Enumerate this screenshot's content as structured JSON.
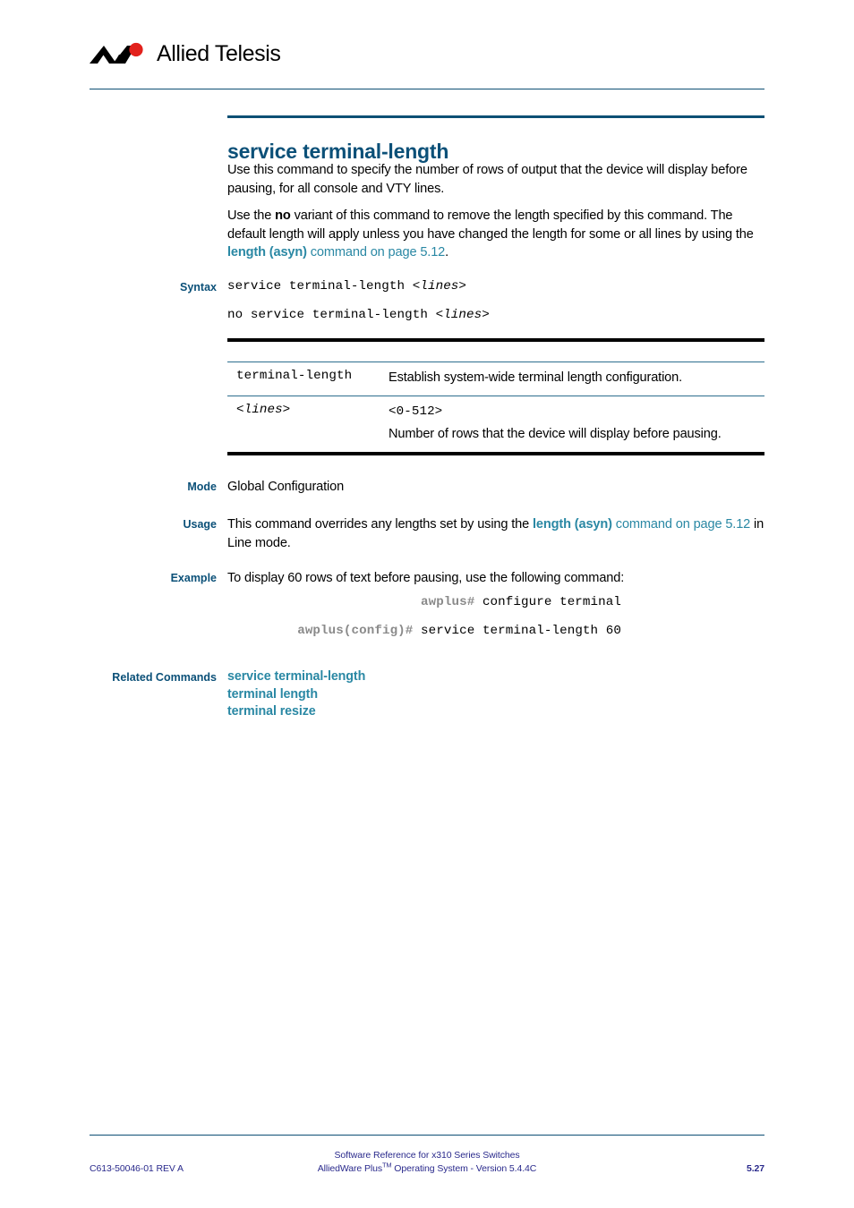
{
  "header": {
    "logo_text": "Allied Telesis",
    "logo_icon": "allied-telesis-chevron-logo"
  },
  "page_title": "service terminal-length",
  "intro": {
    "p1": "Use this command to specify the number of rows of output that the device will display before pausing, for all console and VTY lines.",
    "p2_part1": "Use the ",
    "p2_bold": "no",
    "p2_part2": " variant of this command to remove the length specified by this command. The default length will apply unless you have changed the length for some or all lines by using the ",
    "p2_link_bold": "length (asyn)",
    "p2_link_rest": " command on page 5.12",
    "p2_end": "."
  },
  "syntax": {
    "label": "Syntax",
    "line1_plain": "service terminal-length ",
    "line1_italic": "<lines>",
    "line2_plain": "no service terminal-length ",
    "line2_italic": "<lines>"
  },
  "param_table": {
    "rows": [
      {
        "key": "terminal-length",
        "key_style": "mono",
        "value_mono": "",
        "value_text": "Establish system-wide terminal length configuration."
      },
      {
        "key": "<lines>",
        "key_style": "mono-italic",
        "value_mono": "<0-512>",
        "value_text": "Number of rows that the device will display before pausing."
      }
    ]
  },
  "mode": {
    "label": "Mode",
    "value": "Global Configuration"
  },
  "usage": {
    "label": "Usage",
    "text_part1": "This command overrides any lengths set by using the ",
    "link_bold": "length (asyn)",
    "link_rest": " command on page 5.12",
    "text_part2": " in Line mode."
  },
  "example": {
    "label": "Example",
    "intro": "To display 60 rows of text before pausing, use the following command:",
    "lines": [
      {
        "prompt": "awplus#",
        "command": " configure terminal"
      },
      {
        "prompt": "awplus(config)#",
        "command": " service terminal-length 60"
      }
    ]
  },
  "related_commands": {
    "label": "Related Commands",
    "items": [
      "service terminal-length",
      "terminal length",
      "terminal resize"
    ]
  },
  "footer": {
    "center_line1": "Software Reference for x310 Series Switches",
    "center_line2_part1": "AlliedWare Plus",
    "center_line2_sup": "TM",
    "center_line2_part2": " Operating System - Version 5.4.4C",
    "doc_id": "C613-50046-01 REV A",
    "page_number": "5.27"
  },
  "colors": {
    "heading": "#0b5078",
    "link": "#2a88a4",
    "rule": "#0d4f74",
    "logo_red": "#e2211c",
    "footer": "#2a2a8c"
  }
}
